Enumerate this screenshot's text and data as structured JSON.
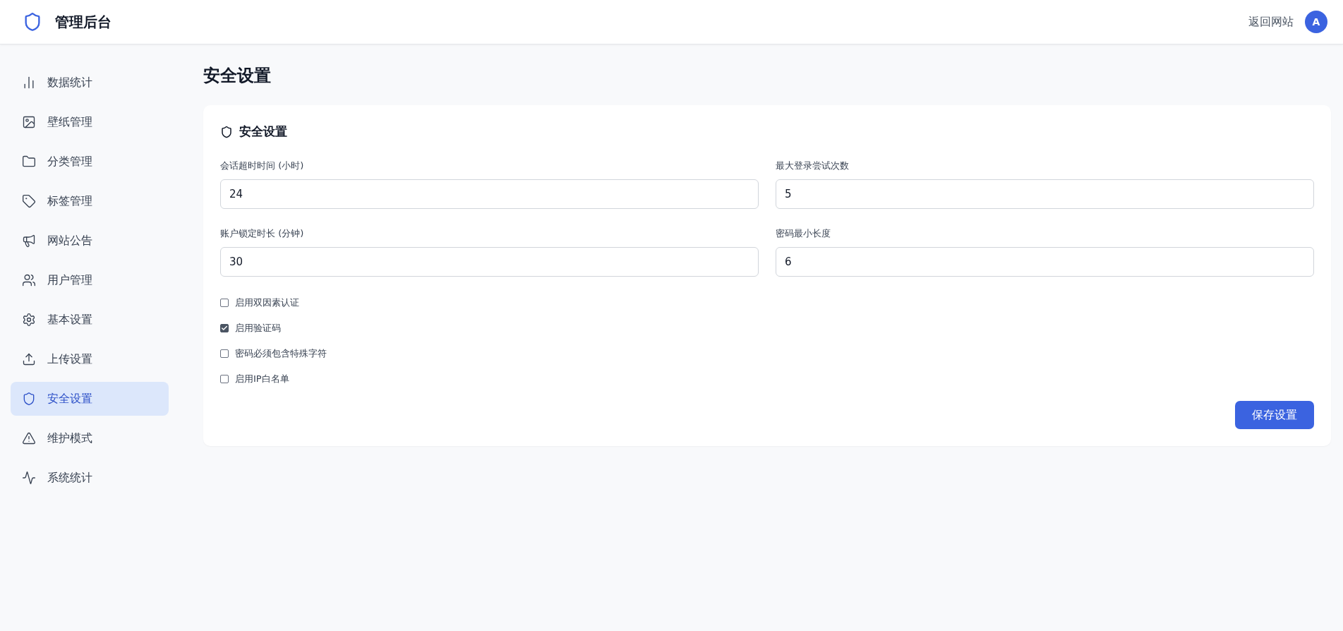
{
  "header": {
    "title": "管理后台",
    "back_link": "返回网站",
    "avatar": "A"
  },
  "sidebar": {
    "items": [
      {
        "label": "数据统计",
        "kind": "chart",
        "selected": false
      },
      {
        "label": "壁纸管理",
        "kind": "image",
        "selected": false
      },
      {
        "label": "分类管理",
        "kind": "folder",
        "selected": false
      },
      {
        "label": "标签管理",
        "kind": "tag",
        "selected": false
      },
      {
        "label": "网站公告",
        "kind": "megaphone",
        "selected": false
      },
      {
        "label": "用户管理",
        "kind": "users",
        "selected": false
      },
      {
        "label": "基本设置",
        "kind": "gear",
        "selected": false
      },
      {
        "label": "上传设置",
        "kind": "upload",
        "selected": false
      },
      {
        "label": "安全设置",
        "kind": "shield",
        "selected": true
      },
      {
        "label": "维护模式",
        "kind": "warning",
        "selected": false
      },
      {
        "label": "系统统计",
        "kind": "pulse",
        "selected": false
      }
    ]
  },
  "page_title": "安全设置",
  "card": {
    "title": "安全设置",
    "fields": [
      {
        "label": "会话超时时间 (小时)",
        "value": "24"
      },
      {
        "label": "最大登录尝试次数",
        "value": "5"
      },
      {
        "label": "账户锁定时长 (分钟)",
        "value": "30"
      },
      {
        "label": "密码最小长度",
        "value": "6"
      }
    ],
    "checkboxes": [
      {
        "label": "启用双因素认证",
        "checked": false
      },
      {
        "label": "启用验证码",
        "checked": true
      },
      {
        "label": "密码必须包含特殊字符",
        "checked": false
      },
      {
        "label": "启用IP白名单",
        "checked": false
      }
    ],
    "save_button": "保存设置"
  }
}
